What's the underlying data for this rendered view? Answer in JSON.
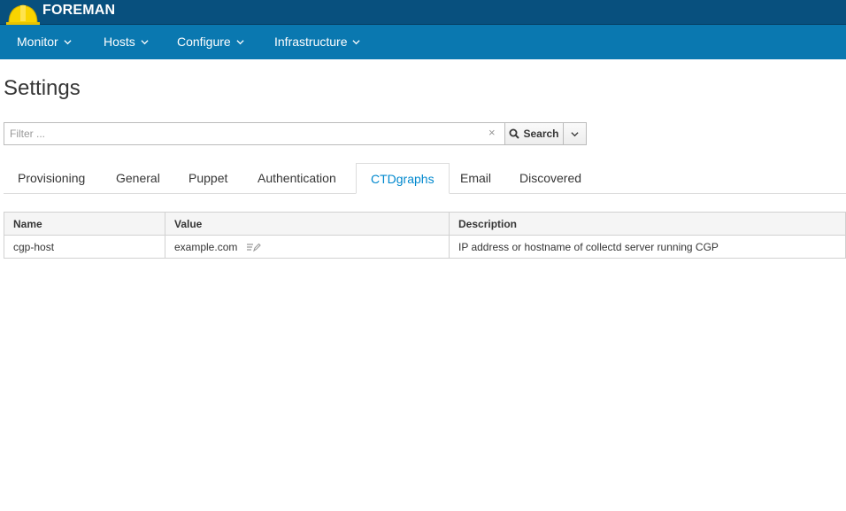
{
  "brand": {
    "name": "FOREMAN",
    "logo_icon": "helmet-icon",
    "logo_color": "#f9d400"
  },
  "nav": {
    "items": [
      {
        "label": "Monitor"
      },
      {
        "label": "Hosts"
      },
      {
        "label": "Configure"
      },
      {
        "label": "Infrastructure"
      }
    ]
  },
  "page": {
    "title": "Settings"
  },
  "search": {
    "placeholder": "Filter ...",
    "value": "",
    "clear_glyph": "×",
    "button_label": "Search"
  },
  "tabs": [
    {
      "label": "Provisioning",
      "active": false
    },
    {
      "label": "General",
      "active": false
    },
    {
      "label": "Puppet",
      "active": false
    },
    {
      "label": "Authentication",
      "active": false
    },
    {
      "label": "CTDgraphs",
      "active": true
    },
    {
      "label": "Email",
      "active": false
    },
    {
      "label": "Discovered",
      "active": false
    }
  ],
  "table": {
    "headers": {
      "name": "Name",
      "value": "Value",
      "description": "Description"
    },
    "rows": [
      {
        "name": "cgp-host",
        "value": "example.com",
        "description": "IP address or hostname of collectd server running CGP"
      }
    ]
  },
  "colors": {
    "brandbar": "#08507e",
    "navbar": "#0a78b0",
    "active_tab": "#0088ce"
  }
}
